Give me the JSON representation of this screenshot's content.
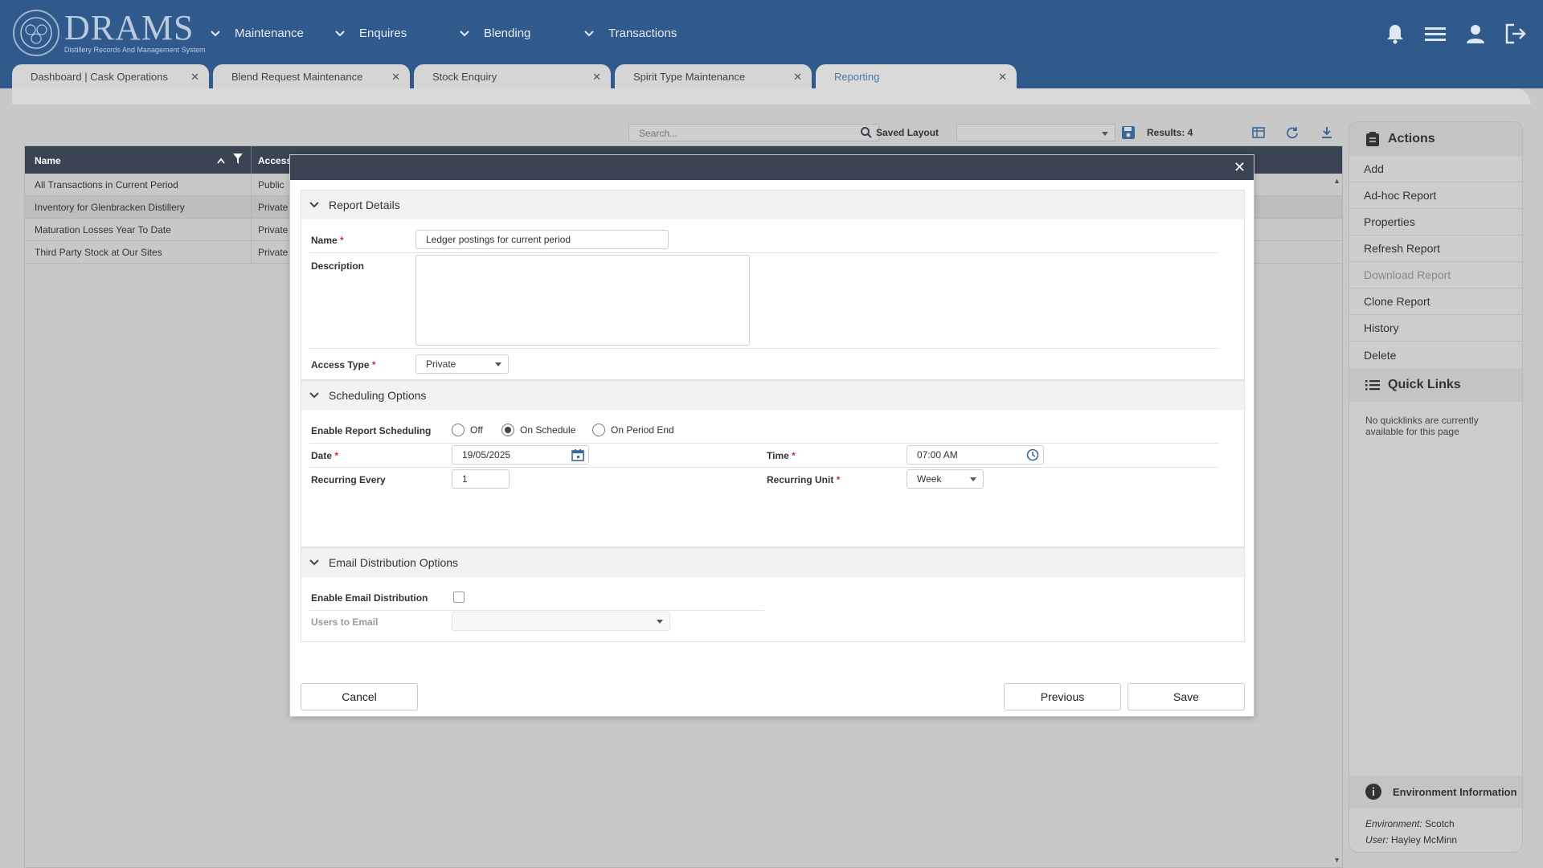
{
  "app": {
    "logo_title": "DRAMS",
    "logo_subtitle": "Distillery Records And Management System"
  },
  "nav": [
    {
      "label": "Maintenance"
    },
    {
      "label": "Enquires"
    },
    {
      "label": "Blending"
    },
    {
      "label": "Transactions"
    }
  ],
  "header_icons": [
    "bell-icon",
    "menu-icon",
    "user-icon",
    "logout-icon"
  ],
  "tabs": [
    {
      "label": "Dashboard | Cask Operations",
      "active": false
    },
    {
      "label": "Blend Request Maintenance",
      "active": false
    },
    {
      "label": "Stock Enquiry",
      "active": false
    },
    {
      "label": "Spirit Type Maintenance",
      "active": false
    },
    {
      "label": "Reporting",
      "active": true
    }
  ],
  "toolbar": {
    "search_placeholder": "Search...",
    "saved_layout_label": "Saved Layout",
    "saved_layout_value": "",
    "results_label": "Results: 4"
  },
  "grid": {
    "columns": [
      "Name",
      "Access"
    ],
    "rows": [
      {
        "name": "All Transactions in Current Period",
        "access": "Public"
      },
      {
        "name": "Inventory for Glenbracken Distillery",
        "access": "Private"
      },
      {
        "name": "Maturation Losses Year To Date",
        "access": "Private"
      },
      {
        "name": "Third Party Stock at Our Sites",
        "access": "Private"
      }
    ]
  },
  "side_panel": {
    "actions_title": "Actions",
    "actions": [
      {
        "label": "Add",
        "enabled": true
      },
      {
        "label": "Ad-hoc Report",
        "enabled": true
      },
      {
        "label": "Properties",
        "enabled": true
      },
      {
        "label": "Refresh Report",
        "enabled": true
      },
      {
        "label": "Download Report",
        "enabled": false
      },
      {
        "label": "Clone Report",
        "enabled": true
      },
      {
        "label": "History",
        "enabled": true
      },
      {
        "label": "Delete",
        "enabled": true
      }
    ],
    "quick_links_title": "Quick Links",
    "quick_links_note": "No quicklinks are currently available for this page",
    "env_title": "Environment Information",
    "env_label": "Environment:",
    "env_value": "Scotch",
    "user_label": "User:",
    "user_value": "Hayley McMinn"
  },
  "modal": {
    "report_details": {
      "title": "Report Details",
      "name_label": "Name",
      "name_value": "Ledger postings for current period",
      "description_label": "Description",
      "description_value": "",
      "access_type_label": "Access Type",
      "access_type_value": "Private"
    },
    "scheduling": {
      "title": "Scheduling Options",
      "enable_label": "Enable Report Scheduling",
      "options": [
        "Off",
        "On Schedule",
        "On Period End"
      ],
      "selected": "On Schedule",
      "date_label": "Date",
      "date_value": "19/05/2025",
      "time_label": "Time",
      "time_value": "07:00 AM",
      "recurring_every_label": "Recurring Every",
      "recurring_every_value": "1",
      "recurring_unit_label": "Recurring Unit",
      "recurring_unit_value": "Week"
    },
    "email": {
      "title": "Email Distribution Options",
      "enable_label": "Enable Email Distribution",
      "enabled": false,
      "users_label": "Users to Email",
      "users_value": ""
    },
    "buttons": {
      "cancel": "Cancel",
      "previous": "Previous",
      "save": "Save"
    }
  }
}
